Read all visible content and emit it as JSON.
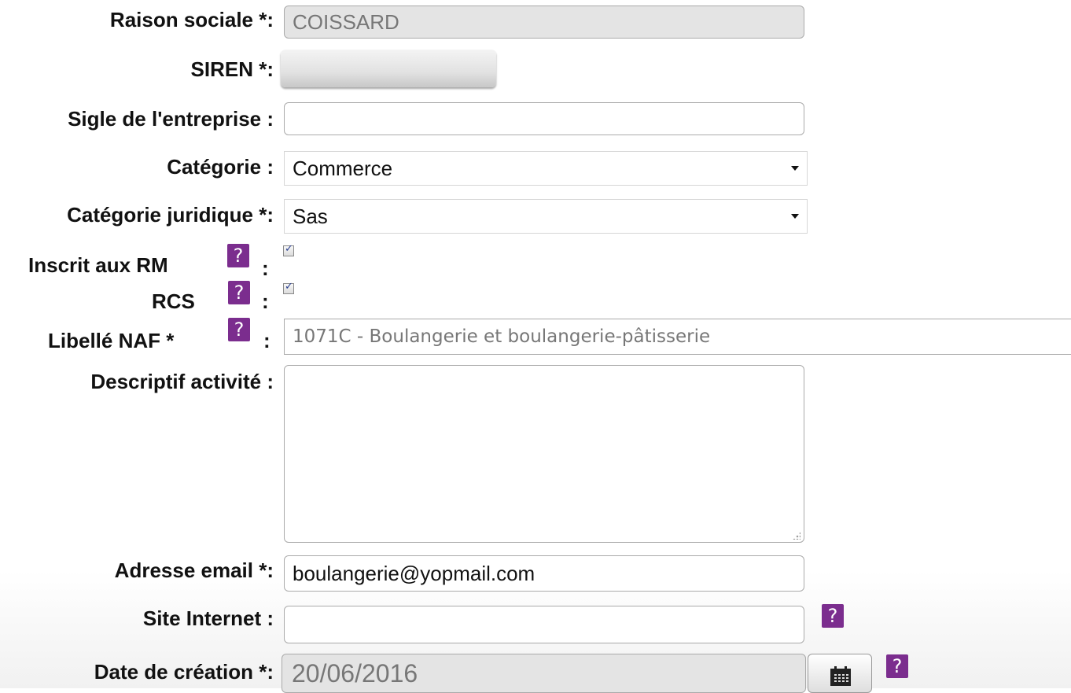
{
  "form": {
    "raison_sociale": {
      "label": "Raison sociale *:",
      "value": "COISSARD"
    },
    "siren": {
      "label": "SIREN *:"
    },
    "sigle": {
      "label": "Sigle de l'entreprise :",
      "value": ""
    },
    "categorie": {
      "label": "Catégorie :",
      "value": "Commerce"
    },
    "categorie_juridique": {
      "label": "Catégorie juridique *:",
      "value": "Sas"
    },
    "inscrit_rm": {
      "label": "Inscrit aux RM",
      "checked": true,
      "help_icon": "question-icon"
    },
    "rcs": {
      "label": "RCS",
      "checked": true,
      "help_icon": "question-icon"
    },
    "libelle_naf": {
      "label": "Libellé NAF *",
      "value": "1071C - Boulangerie et boulangerie-pâtisserie",
      "help_icon": "question-icon"
    },
    "descriptif": {
      "label": "Descriptif activité :",
      "value": ""
    },
    "email": {
      "label": "Adresse email *:",
      "value": "boulangerie@yopmail.com"
    },
    "site": {
      "label": "Site Internet :",
      "value": "",
      "help_icon": "question-icon"
    },
    "date_creation": {
      "label": "Date de création *:",
      "value": "20/06/2016",
      "calendar_icon": "calendar-icon",
      "help_icon": "question-icon"
    }
  },
  "glyphs": {
    "help": "?",
    "colon": ":",
    "check": "✓"
  },
  "colors": {
    "help_icon_bg": "#7b2d8e",
    "readonly_bg": "#e4e4e4",
    "checkbox_check": "#2a3f8f"
  }
}
